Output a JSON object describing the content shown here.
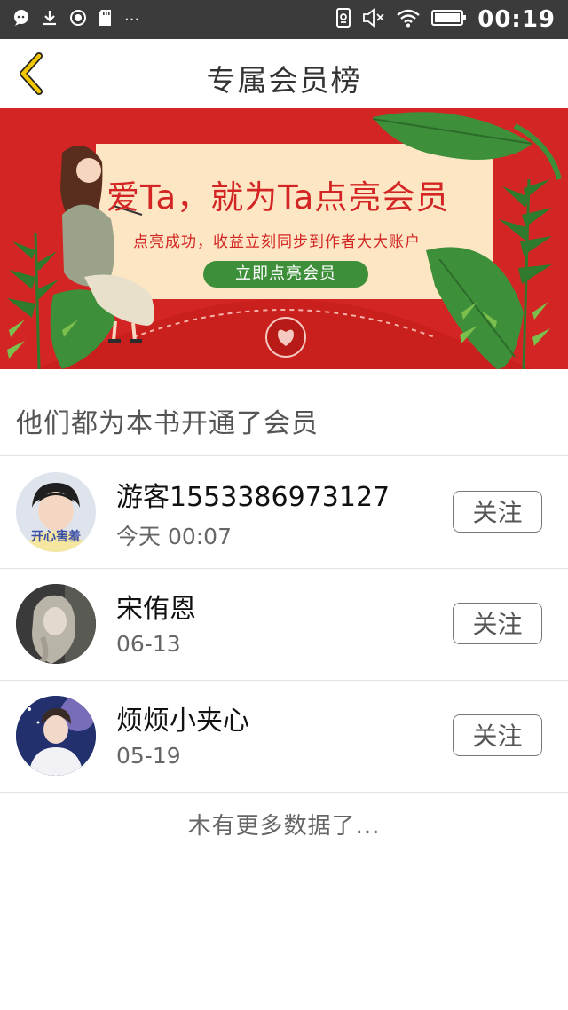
{
  "status_bar": {
    "time": "00:19",
    "left_icons": [
      "message-icon",
      "download-icon",
      "record-icon",
      "sd-card-icon"
    ],
    "left_more": "···",
    "right_icons": [
      "nfc-icon",
      "mute-icon",
      "wifi-icon",
      "battery-icon"
    ]
  },
  "header": {
    "title": "专属会员榜",
    "back_icon": "chevron-left-icon",
    "accent_color": "#f2c600"
  },
  "banner": {
    "headline": "爱Ta，就为Ta点亮会员",
    "subtext": "点亮成功，收益立刻同步到作者大大账户",
    "button_label": "立即点亮会员",
    "background_color": "#d32624",
    "button_color": "#3e8f3a"
  },
  "section": {
    "title": "他们都为本书开通了会员"
  },
  "members": [
    {
      "name": "游客1553386973127",
      "date": "今天  00:07",
      "follow_label": "关注",
      "avatar_text": "开心害羞"
    },
    {
      "name": "宋侑恩",
      "date": "06-13",
      "follow_label": "关注"
    },
    {
      "name": "烦烦小夹心",
      "date": "05-19",
      "follow_label": "关注"
    }
  ],
  "footer": {
    "text": "木有更多数据了..."
  }
}
